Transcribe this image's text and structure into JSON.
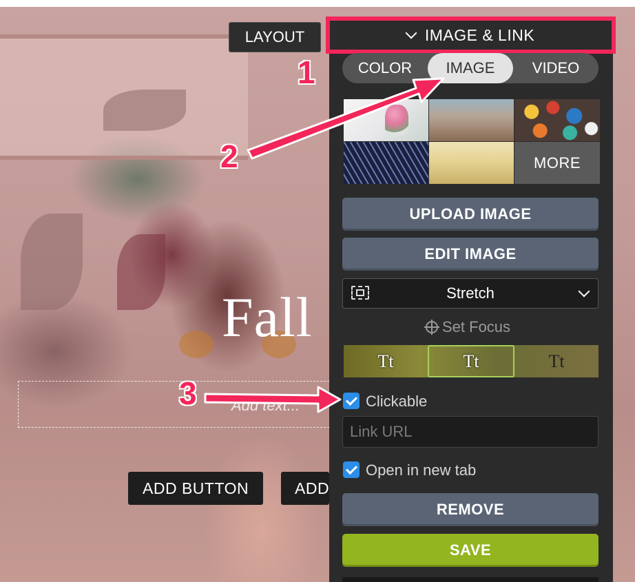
{
  "canvas": {
    "title": "Fall",
    "text_placeholder": "Add text...",
    "buttons": [
      "ADD BUTTON",
      "ADD"
    ],
    "layout_label": "LAYOUT"
  },
  "panel": {
    "header": "IMAGE & LINK",
    "tabs": [
      {
        "label": "COLOR",
        "active": false
      },
      {
        "label": "IMAGE",
        "active": true
      },
      {
        "label": "VIDEO",
        "active": false
      }
    ],
    "thumbnails": [
      "flowers-vase",
      "city-street",
      "paint-cups",
      "glass-building",
      "wheat-field"
    ],
    "more_label": "MORE",
    "upload_label": "UPLOAD IMAGE",
    "edit_label": "EDIT IMAGE",
    "fit_select": "Stretch",
    "set_focus": "Set Focus",
    "text_styles": [
      "Tt",
      "Tt",
      "Tt"
    ],
    "clickable_label": "Clickable",
    "clickable_checked": true,
    "link_placeholder": "Link URL",
    "new_tab_label": "Open in new tab",
    "new_tab_checked": true,
    "remove_label": "REMOVE",
    "save_label": "SAVE"
  },
  "annotations": [
    "1",
    "2",
    "3"
  ],
  "colors": {
    "highlight": "#f2265a",
    "panel_bg": "#2b2b2b",
    "button": "#5a6475",
    "save": "#93b51f",
    "checkbox": "#2b8ee8"
  }
}
